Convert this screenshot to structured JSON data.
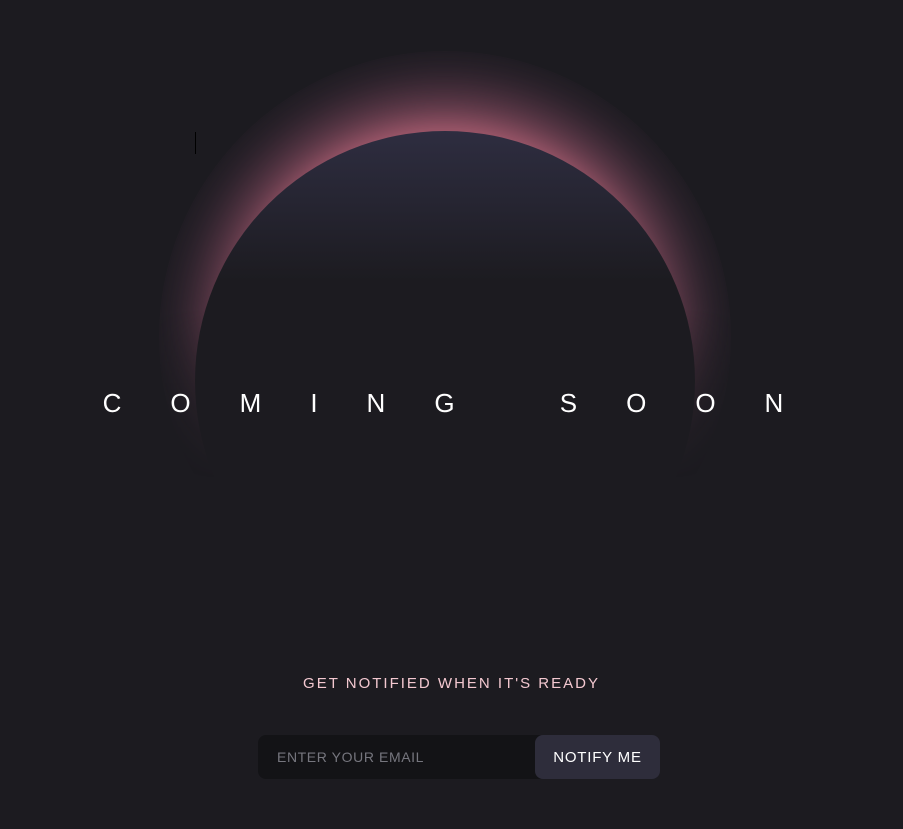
{
  "hero": {
    "headline": "COMING SOON"
  },
  "signup": {
    "heading": "GET NOTIFIED WHEN IT'S READY",
    "email_placeholder": "ENTER YOUR EMAIL",
    "email_value": "",
    "button_label": "NOTIFY ME"
  },
  "colors": {
    "background": "#1c1b20",
    "glow_accent": "#ec7c94",
    "planet_top": "#2e2d40",
    "heading_tint": "#f3c8d0",
    "button_bg": "#2e2d3b",
    "input_bg": "#131316"
  }
}
